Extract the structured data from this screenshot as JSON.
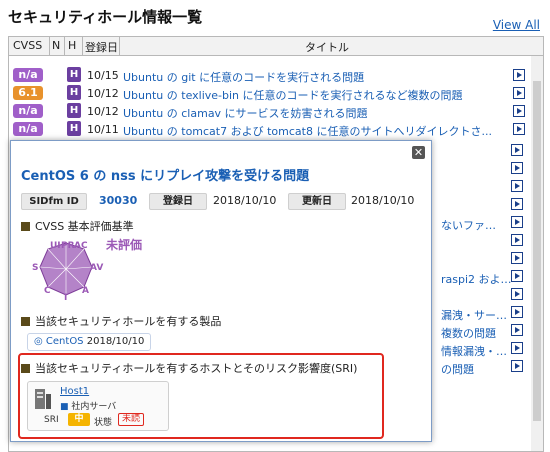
{
  "page": {
    "title": "セキュリティホール情報一覧",
    "view_all": "View All"
  },
  "table": {
    "headers": {
      "cvss": "CVSS",
      "n": "N",
      "h": "H",
      "date": "登録日",
      "title": "タイトル"
    },
    "rows": [
      {
        "score": "n/a",
        "score_color": "#a05fc9",
        "level": "H",
        "date": "10/15",
        "title": "Ubuntu の git に任意のコードを実行される問題"
      },
      {
        "score": "6.1",
        "score_color": "#e8922c",
        "level": "H",
        "date": "10/12",
        "title": "Ubuntu の texlive-bin に任意のコードを実行されるなど複数の問題"
      },
      {
        "score": "n/a",
        "score_color": "#a05fc9",
        "level": "H",
        "date": "10/12",
        "title": "Ubuntu の clamav にサービスを妨害される問題"
      },
      {
        "score": "n/a",
        "score_color": "#a05fc9",
        "level": "H",
        "date": "10/11",
        "title": "Ubuntu の tomcat7 および tomcat8 に任意のサイトへリダイレクトさ..."
      }
    ],
    "partial_rows": [
      {
        "text": ""
      },
      {
        "text": ""
      },
      {
        "text": ""
      },
      {
        "text": "ないファ…"
      },
      {
        "text": ""
      },
      {
        "text": ""
      },
      {
        "text": "raspi2 およ…"
      },
      {
        "text": ""
      },
      {
        "text": "漏洩・サー…"
      },
      {
        "text": "複数の問題"
      },
      {
        "text": "情報漏洩・…"
      },
      {
        "text": "の問題"
      }
    ]
  },
  "popup": {
    "title": "CentOS 6 の nss にリプレイ攻撃を受ける問題",
    "sidfm_label": "SIDfm ID",
    "sidfm_value": "30030",
    "registered_label": "登録日",
    "registered_value": "2018/10/10",
    "updated_label": "更新日",
    "updated_value": "2018/10/10",
    "cvss_section": "CVSS 基本評価基準",
    "unrated": "未評価",
    "radar_labels": {
      "ui": "UI",
      "pr": "PR",
      "ac": "AC",
      "s": "S",
      "av": "AV",
      "c": "C",
      "i": "I",
      "a": "A"
    },
    "products_section": "当該セキュリティホールを有する製品",
    "product_name": "CentOS",
    "product_date": "2018/10/10",
    "hosts_section": "当該セキュリティホールを有するホストとそのリスク影響度(SRI)",
    "host": {
      "name": "Host1",
      "group": "社内サーバ",
      "sri_label": "SRI",
      "sri_value": "中",
      "status_label": "状態",
      "status_value": "未読"
    },
    "colors": {
      "radar": "#9b59b6",
      "sri": "#f5b400",
      "alert": "#e0281f"
    }
  }
}
